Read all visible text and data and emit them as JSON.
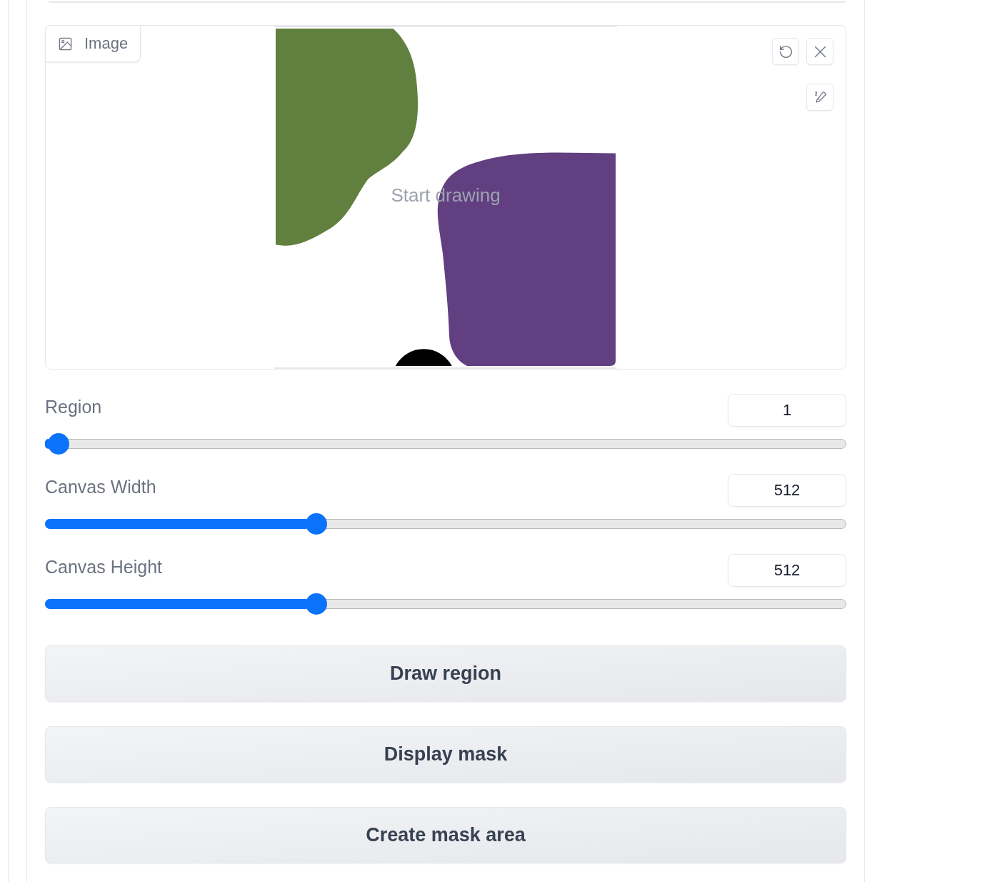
{
  "image_editor": {
    "label": "Image",
    "placeholder": "Start drawing"
  },
  "sliders": [
    {
      "label": "Region",
      "value": "1",
      "level": 0
    },
    {
      "label": "Canvas Width",
      "value": "512",
      "level": 0.333
    },
    {
      "label": "Canvas Height",
      "value": "512",
      "level": 0.333
    }
  ],
  "buttons": [
    "Draw region",
    "Display mask",
    "Create mask area"
  ]
}
